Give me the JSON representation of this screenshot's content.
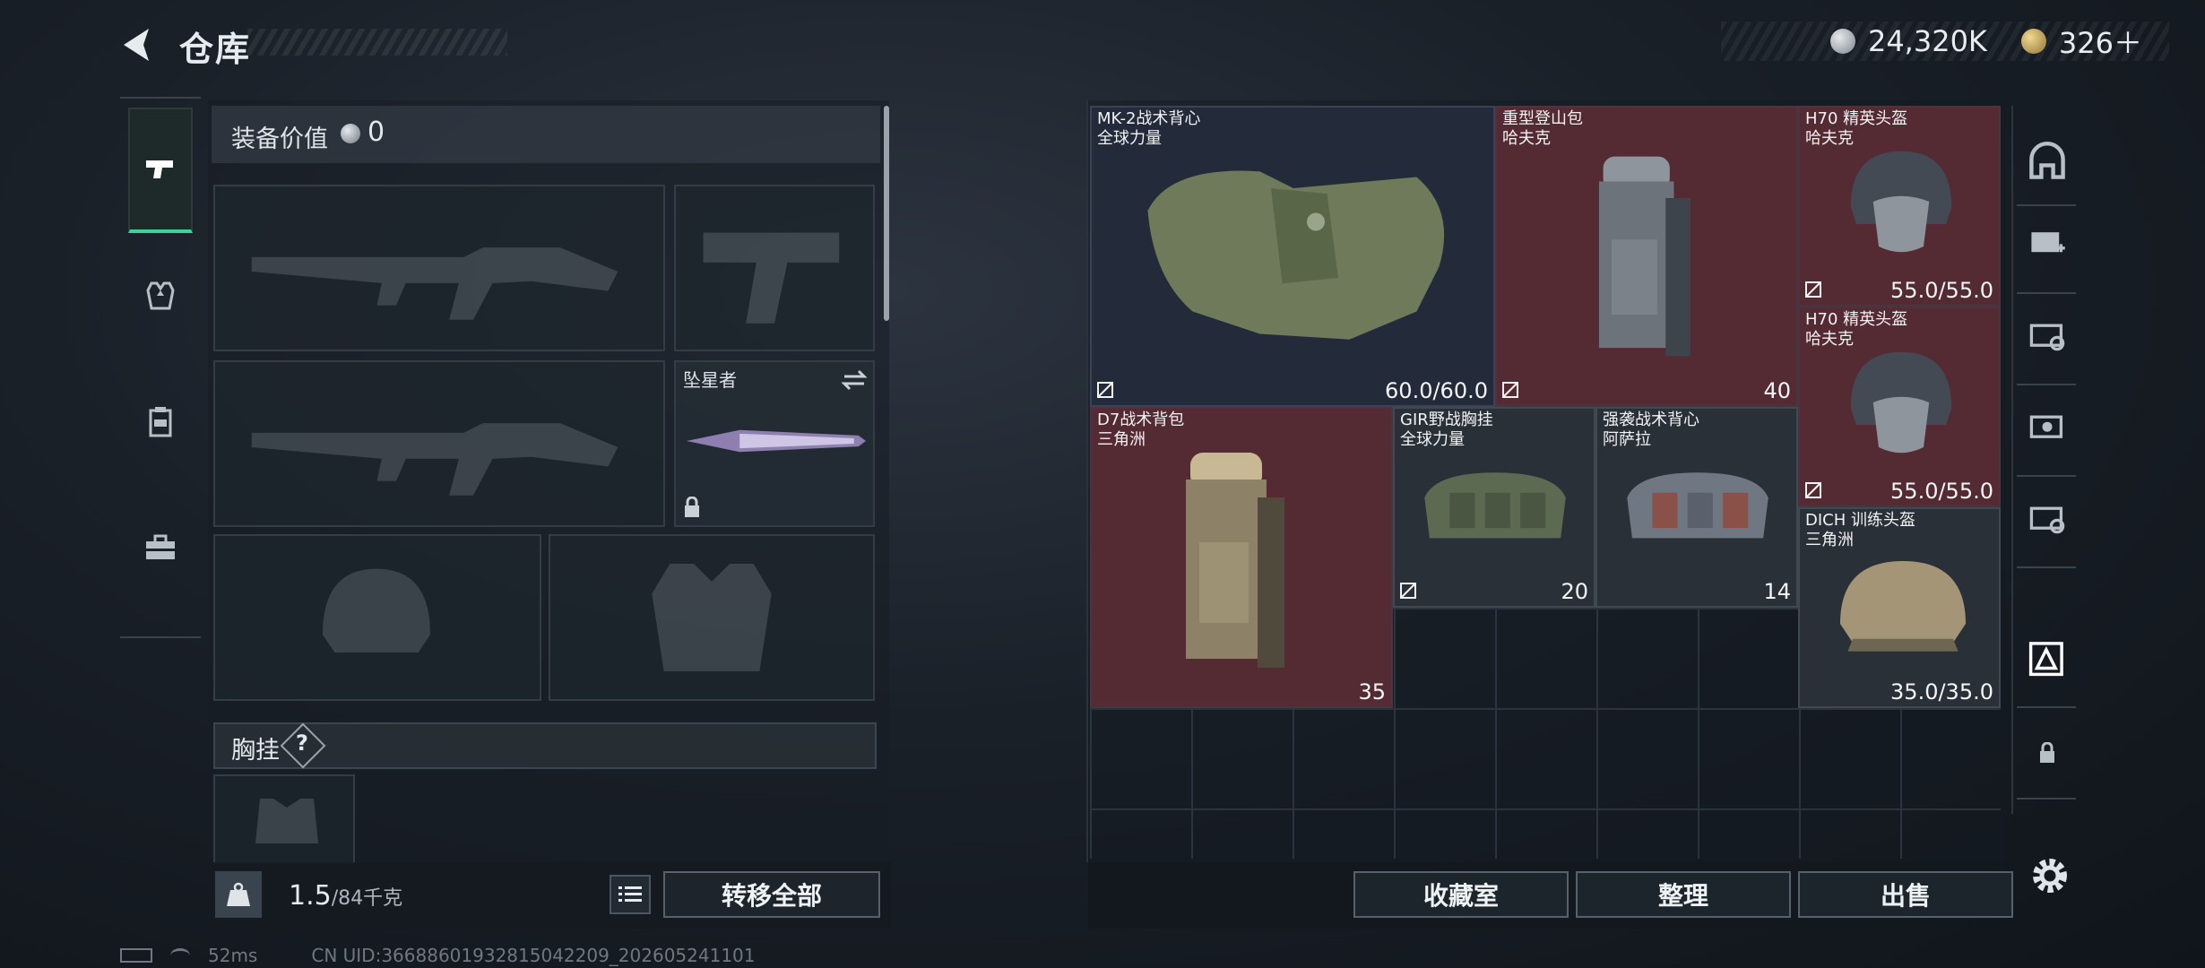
{
  "header": {
    "title": "仓库"
  },
  "currency": {
    "silver": "24,320K",
    "gold": "326＋"
  },
  "equipment": {
    "value_label": "装备价值",
    "value": "0",
    "melee_name": "坠星者",
    "chest_label": "胸挂",
    "help": "?"
  },
  "footer": {
    "weight_current": "1.5",
    "weight_max": "/84千克",
    "transfer_all": "转移全部",
    "collection": "收藏室",
    "sort": "整理",
    "sell": "出售"
  },
  "items": [
    {
      "name": "MK-2战术背心",
      "brand": "全球力量",
      "stat": "60.0/60.0",
      "bg": "navy"
    },
    {
      "name": "重型登山包",
      "brand": "哈夫克",
      "stat": "40",
      "bg": "red"
    },
    {
      "name": "H70 精英头盔",
      "brand": "哈夫克",
      "stat": "55.0/55.0",
      "bg": "red"
    },
    {
      "name": "H70 精英头盔",
      "brand": "哈夫克",
      "stat": "55.0/55.0",
      "bg": "red"
    },
    {
      "name": "D7战术背包",
      "brand": "三角洲",
      "stat": "35",
      "bg": "red"
    },
    {
      "name": "GIR野战胸挂",
      "brand": "全球力量",
      "stat": "20",
      "bg": "grey"
    },
    {
      "name": "强袭战术背心",
      "brand": "阿萨拉",
      "stat": "14",
      "bg": "grey"
    },
    {
      "name": "DICH 训练头盔",
      "brand": "三角洲",
      "stat": "35.0/35.0",
      "bg": "grey"
    }
  ],
  "status": {
    "ping": "52ms",
    "uid": "CN UID:366886019328150422​09_202605241101"
  },
  "icons": [
    "back-arrow-icon",
    "silver-coin-icon",
    "gold-coin-icon",
    "pistol-icon",
    "armor-icon",
    "backpack-icon",
    "toolbox-icon",
    "lock-icon",
    "swap-icon",
    "gear-icon",
    "weight-icon",
    "list-icon"
  ],
  "colors": {
    "accent": "#3fd19a",
    "rarity_red": "#542a33",
    "rarity_navy": "#232a3a"
  }
}
